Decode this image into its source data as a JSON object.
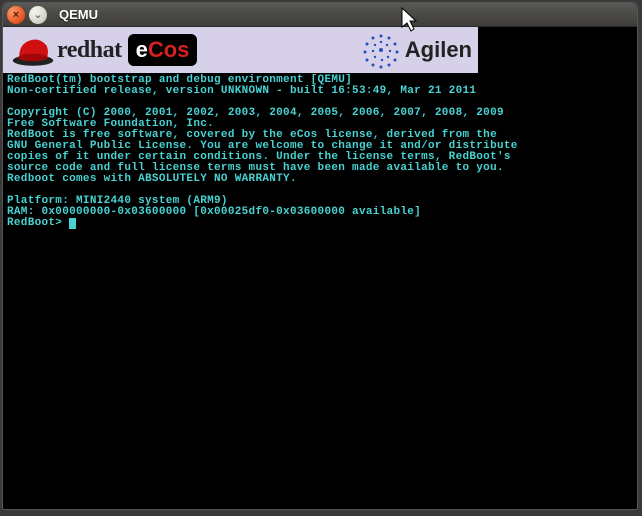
{
  "window": {
    "title": "QEMU",
    "close_glyph": "×",
    "min_glyph": "⌄"
  },
  "banner": {
    "redhat_text": "redhat",
    "ecos_e": "e",
    "ecos_c": "C",
    "ecos_os": "os",
    "agilent_text": "Agilen"
  },
  "terminal": {
    "line1": "RedBoot(tm) bootstrap and debug environment [QEMU]",
    "line2": "Non-certified release, version UNKNOWN - built 16:53:49, Mar 21 2011",
    "blank1": "",
    "line3": "Copyright (C) 2000, 2001, 2002, 2003, 2004, 2005, 2006, 2007, 2008, 2009",
    "line4": "Free Software Foundation, Inc.",
    "line5": "RedBoot is free software, covered by the eCos license, derived from the",
    "line6": "GNU General Public License. You are welcome to change it and/or distribute",
    "line7": "copies of it under certain conditions. Under the license terms, RedBoot's",
    "line8": "source code and full license terms must have been made available to you.",
    "line9": "Redboot comes with ABSOLUTELY NO WARRANTY.",
    "blank2": "",
    "line10": "Platform: MINI2440 system (ARM9)",
    "line11": "RAM: 0x00000000-0x03600000 [0x00025df0-0x03600000 available]",
    "prompt": "RedBoot> "
  },
  "colors": {
    "terminal_fg": "#48d2d2",
    "terminal_bg": "#000000",
    "banner_bg": "#d6d0e8"
  }
}
